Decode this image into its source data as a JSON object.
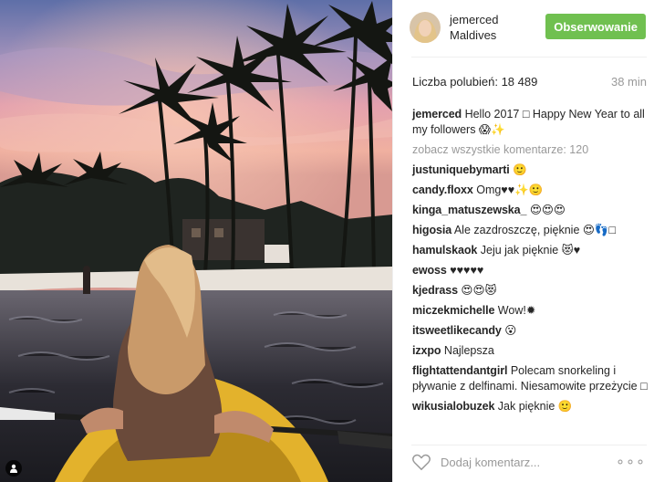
{
  "post": {
    "username": "jemerced",
    "location": "Maldives",
    "follow_label": "Obserwowanie",
    "likes_label": "Liczba polubień: 18 489",
    "time": "38 min",
    "view_all": "zobacz wszystkie komentarze: 120",
    "add_comment_placeholder": "Dodaj komentarz...",
    "more": "∘∘∘"
  },
  "caption": {
    "user": "jemerced",
    "text": " Hello 2017 □ Happy New Year to all my followers 😱✨"
  },
  "comments": [
    {
      "user": "justuniquebymarti",
      "text": " 🙂"
    },
    {
      "user": "candy.floxx",
      "text": " Omg♥♥✨🙂"
    },
    {
      "user": "kinga_matuszewska_",
      "text": " 😍😍😍"
    },
    {
      "user": "higosia",
      "text": " Ale zazdroszczę, pięknie 😍👣□"
    },
    {
      "user": "hamulskaok",
      "text": " Jeju jak pięknie 😻♥"
    },
    {
      "user": "ewoss",
      "text": " ♥♥♥♥♥"
    },
    {
      "user": "kjedrass",
      "text": " 😍😍😻"
    },
    {
      "user": "miczekmichelle",
      "text": " Wow!✹"
    },
    {
      "user": "itsweetlikecandy",
      "text": " 😮"
    },
    {
      "user": "izxpo",
      "text": " Najlepsza"
    },
    {
      "user": "flightattendantgirl",
      "text": " Polecam snorkeling i pływanie z delfinami. Niesamowite przeżycie □"
    },
    {
      "user": "wikusialobuzek",
      "text": " Jak pięknie 🙂"
    }
  ],
  "colors": {
    "follow_button": "#70c050",
    "muted_text": "#999999"
  },
  "icons": {
    "heart": "heart-outline-icon",
    "user_tag": "person-icon",
    "more": "more-dots-icon"
  }
}
